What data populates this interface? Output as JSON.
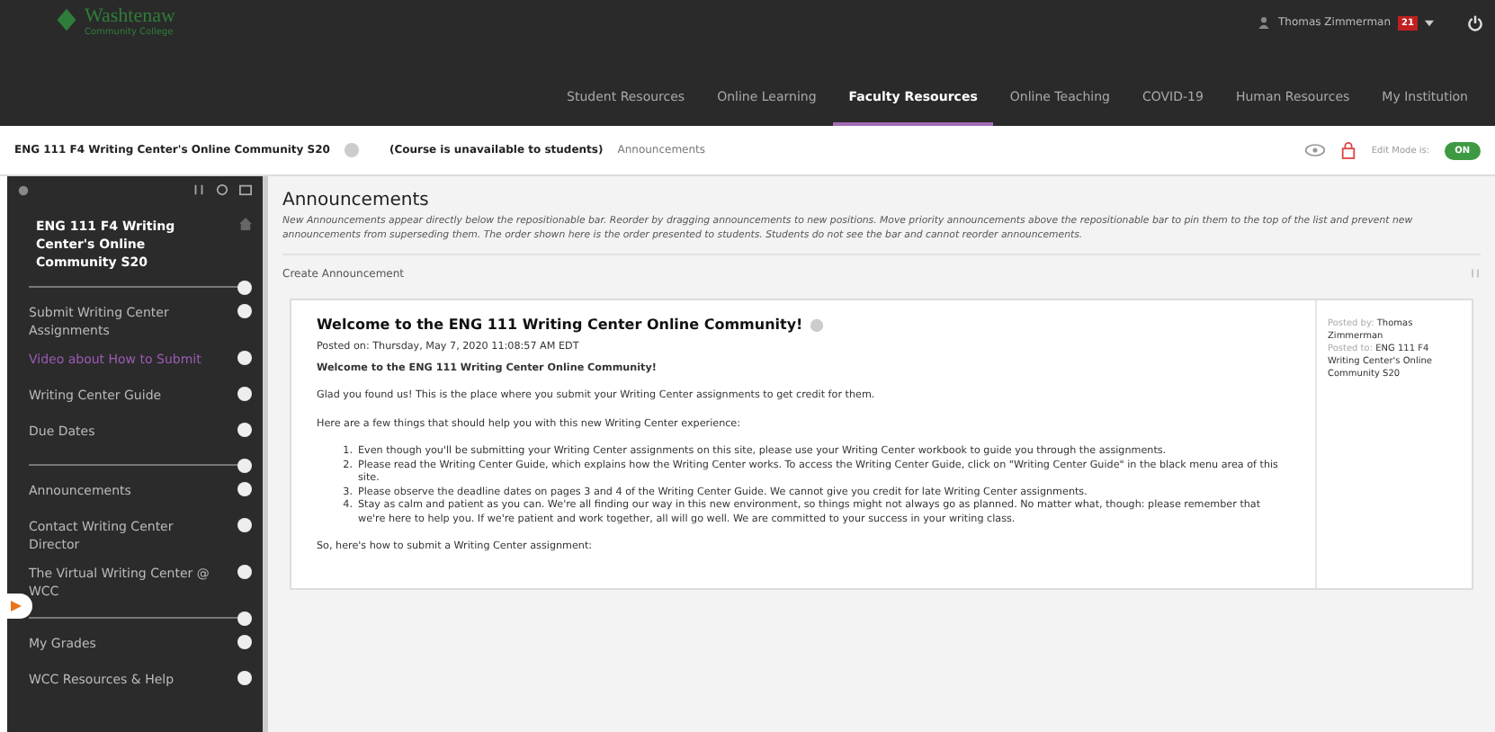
{
  "header": {
    "logo": {
      "name": "Washtenaw",
      "subtitle": "Community College"
    },
    "user": "Thomas Zimmerman",
    "notifications": "21"
  },
  "nav": [
    {
      "label": "Student Resources",
      "selected": false
    },
    {
      "label": "Online Learning",
      "selected": false
    },
    {
      "label": "Faculty Resources",
      "selected": true
    },
    {
      "label": "Online Teaching",
      "selected": false
    },
    {
      "label": "COVID-19",
      "selected": false
    },
    {
      "label": "Human Resources",
      "selected": false
    },
    {
      "label": "My Institution",
      "selected": false
    }
  ],
  "breadcrumb": {
    "course": "ENG 111 F4 Writing Center's Online Community S20",
    "status": "(Course is unavailable to students)",
    "page": "Announcements",
    "edit_mode": {
      "label": "Edit Mode is:",
      "value": "ON",
      "on": true
    }
  },
  "sidebar": {
    "course_title": "ENG 111 F4 Writing Center's Online Community S20",
    "items": [
      {
        "kind": "divider"
      },
      {
        "kind": "link",
        "label": "Submit Writing Center Assignments",
        "selected": false
      },
      {
        "kind": "link",
        "label": "Video about How to Submit",
        "selected": true
      },
      {
        "kind": "link",
        "label": "Writing Center Guide",
        "selected": false
      },
      {
        "kind": "link",
        "label": "Due Dates",
        "selected": false
      },
      {
        "kind": "divider"
      },
      {
        "kind": "link",
        "label": "Announcements",
        "selected": false
      },
      {
        "kind": "link",
        "label": "Contact Writing Center Director",
        "selected": false
      },
      {
        "kind": "link",
        "label": "The Virtual Writing Center @ WCC",
        "selected": false
      },
      {
        "kind": "divider"
      },
      {
        "kind": "link",
        "label": "My Grades",
        "selected": false
      },
      {
        "kind": "link",
        "label": "WCC Resources & Help",
        "selected": false
      }
    ]
  },
  "page": {
    "title": "Announcements",
    "description": "New Announcements appear directly below the repositionable bar. Reorder by dragging announcements to new positions. Move priority announcements above the repositionable bar to pin them to the top of the list and prevent new announcements from superseding them. The order shown here is the order presented to students. Students do not see the bar and cannot reorder announcements.",
    "create_button": "Create Announcement"
  },
  "announcement": {
    "title": "Welcome to the ENG 111 Writing Center Online Community!",
    "posted_on": "Posted on: Thursday, May 7, 2020 11:08:57 AM EDT",
    "heading": "Welcome to the ENG 111 Writing Center Online Community!",
    "intro": "Glad you found us! This is the place where you submit your Writing Center assignments to get credit for them.",
    "lead": "Here are a few things that should help you with this new Writing Center experience:",
    "list": [
      {
        "marker": "1.",
        "text": "Even though you'll be submitting your Writing Center assignments on this site, please use your Writing Center workbook to guide you through the assignments."
      },
      {
        "marker": "2.",
        "text": "Please read the Writing Center Guide, which explains how the Writing Center works. To access the Writing Center Guide, click on \"Writing Center Guide\" in the black menu area of this site."
      },
      {
        "marker": "3.",
        "text": "Please observe the deadline dates on pages 3 and 4 of the Writing Center Guide. We cannot give you credit for late Writing Center assignments."
      },
      {
        "marker": "4.",
        "text": "Stay as calm and patient as you can. We're all finding our way in this new environment, so things might not always go as planned. No matter what, though: please remember that we're here to help you. If we're patient and work together, all will go well. We are committed to your success in your writing class."
      }
    ],
    "outro": "So, here's how to submit a Writing Center assignment:",
    "meta": {
      "posted_by_label": "Posted by:",
      "posted_by": "Thomas Zimmerman",
      "posted_to_label": "Posted to:",
      "posted_to": "ENG 111 F4 Writing Center's Online Community S20"
    }
  }
}
